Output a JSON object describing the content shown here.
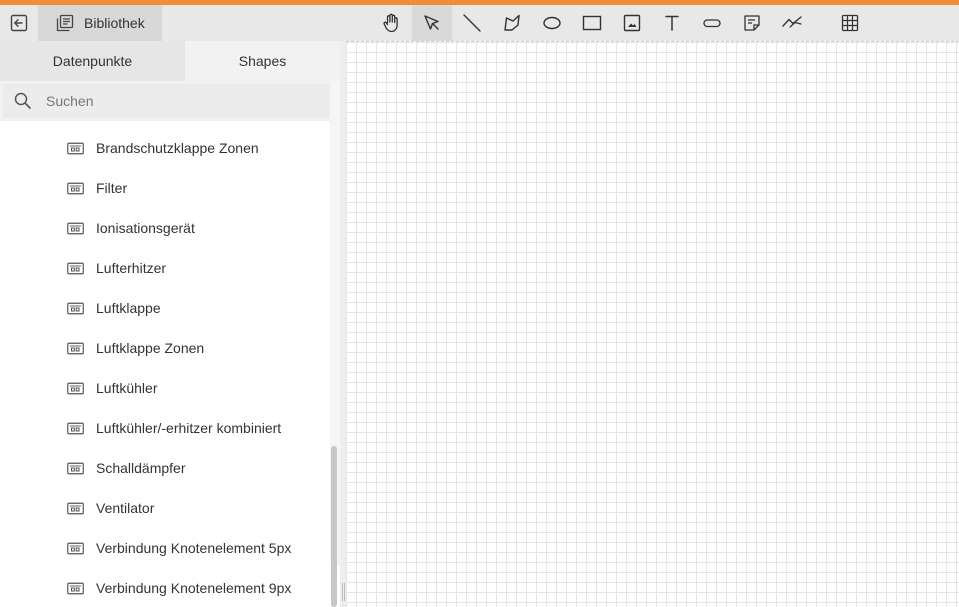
{
  "header": {
    "back_icon": "exit-to-left-icon",
    "library_label": "Bibliothek",
    "library_icon": "library-icon"
  },
  "toolbar": {
    "tools": [
      {
        "name": "hand-tool",
        "icon": "hand-icon"
      },
      {
        "name": "select-tool",
        "icon": "cursor-arrow-icon",
        "active": true
      },
      {
        "name": "line-tool",
        "icon": "line-icon"
      },
      {
        "name": "polygon-tool",
        "icon": "polygon-icon"
      },
      {
        "name": "ellipse-tool",
        "icon": "ellipse-icon"
      },
      {
        "name": "rectangle-tool",
        "icon": "rectangle-icon"
      },
      {
        "name": "image-tool",
        "icon": "image-icon"
      },
      {
        "name": "text-tool",
        "icon": "text-icon"
      },
      {
        "name": "rounded-rect-tool",
        "icon": "pill-icon"
      },
      {
        "name": "note-tool",
        "icon": "note-icon"
      },
      {
        "name": "curve-tool",
        "icon": "trend-icon"
      },
      {
        "name": "grid-toggle",
        "icon": "grid-icon"
      }
    ]
  },
  "sidebar": {
    "tabs": [
      {
        "label": "Datenpunkte",
        "active": false
      },
      {
        "label": "Shapes",
        "active": true
      }
    ],
    "search": {
      "placeholder": "Suchen",
      "value": ""
    },
    "items": [
      {
        "label": "Brandschutzklappe Zonen"
      },
      {
        "label": "Filter"
      },
      {
        "label": "Ionisationsgerät"
      },
      {
        "label": "Lufterhitzer"
      },
      {
        "label": "Luftklappe"
      },
      {
        "label": "Luftklappe Zonen"
      },
      {
        "label": "Luftkühler"
      },
      {
        "label": "Luftkühler/-erhitzer kombiniert"
      },
      {
        "label": "Schalldämpfer"
      },
      {
        "label": "Ventilator"
      },
      {
        "label": "Verbindung Knotenelement 5px"
      },
      {
        "label": "Verbindung Knotenelement 9px"
      }
    ],
    "item_icon": "shape-component-icon"
  },
  "colors": {
    "accent": "#f28c38",
    "topbar": "#e8e8e8",
    "grid_line": "#e6e6e6"
  }
}
